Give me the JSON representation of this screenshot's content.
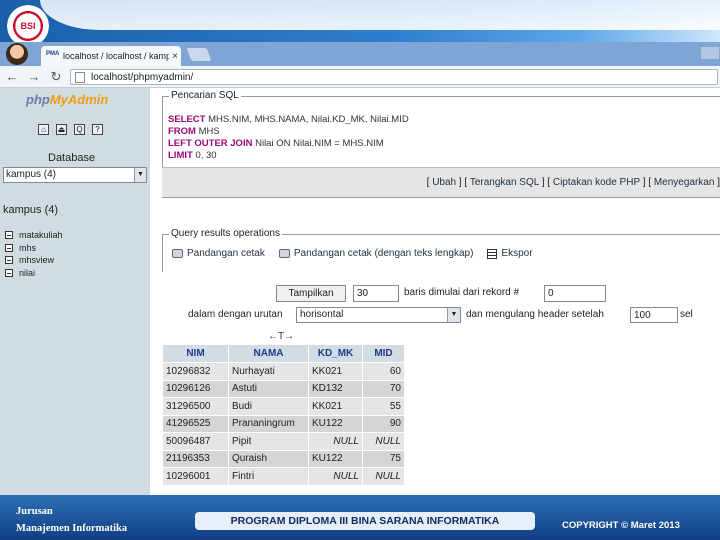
{
  "browser": {
    "tab_title": "localhost / localhost / kampu",
    "tab_close": "×",
    "address": "localhost/phpmyadmin/",
    "back_icon": "←",
    "forward_icon": "→",
    "reload_icon": "↻",
    "favicon_text": "PMA"
  },
  "sidebar": {
    "logo_php": "php",
    "logo_myadmin": "MyAdmin",
    "database_label": "Database",
    "database_select": "kampus (4)",
    "db_heading": "kampus (4)",
    "tables": [
      "matakuliah",
      "mhs",
      "mhsview",
      "nilai"
    ]
  },
  "sql": {
    "legend": "Pencarian SQL",
    "lines": [
      {
        "kw": "SELECT",
        "rest": " MHS.NIM, MHS.NAMA, Nilai.KD_MK, Nilai.MID"
      },
      {
        "kw": "FROM",
        "rest": " MHS"
      },
      {
        "kw": "LEFT OUTER JOIN",
        "rest": " Nilai ON Nilai.NIM = MHS.NIM"
      },
      {
        "kw": "LIMIT",
        "rest": " 0, 30"
      }
    ],
    "links": [
      "Ubah",
      "Terangkan SQL",
      "Ciptakan kode PHP",
      "Menyegarkan"
    ]
  },
  "query_ops": {
    "legend": "Query results operations",
    "print_view": "Pandangan cetak",
    "print_view_full": "Pandangan cetak (dengan teks lengkap)",
    "export": "Ekspor"
  },
  "navigation": {
    "show_button": "Tampilkan",
    "rows_value": "30",
    "rows_text": "baris dimulai dari rekord #",
    "start_value": "0",
    "mode_prefix": "dalam dengan urutan",
    "mode_value": "horisontal",
    "repeat_text": "dan mengulang header setelah",
    "repeat_value": "100",
    "cells_text": "sel"
  },
  "results": {
    "sort_arrows": "←T→",
    "columns": [
      "NIM",
      "NAMA",
      "KD_MK",
      "MID"
    ],
    "rows": [
      [
        "10296832",
        "Nurhayati",
        "KK021",
        "60"
      ],
      [
        "10296126",
        "Astuti",
        "KD132",
        "70"
      ],
      [
        "31296500",
        "Budi",
        "KK021",
        "55"
      ],
      [
        "41296525",
        "Prananingrum",
        "KU122",
        "90"
      ],
      [
        "50096487",
        "Pipit",
        "NULL",
        "NULL"
      ],
      [
        "21196353",
        "Quraish",
        "KU122",
        "75"
      ],
      [
        "10296001",
        "Fintri",
        "NULL",
        "NULL"
      ]
    ]
  },
  "footer": {
    "left_line1": "Jurusan",
    "left_line2": "Manajemen Informatika",
    "center": "PROGRAM DIPLOMA III BINA SARANA INFORMATIKA",
    "right": "COPYRIGHT © Maret 2013"
  },
  "colors": {
    "header_blue": "#1a5fa8",
    "sidebar_bg": "#d0dce0",
    "sql_keyword": "#a0087a",
    "table_header": "#d3dce3",
    "footer_blue": "#0f3f82"
  }
}
